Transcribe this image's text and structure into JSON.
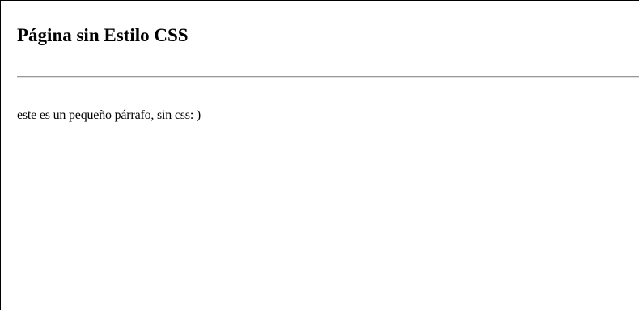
{
  "page": {
    "heading": "Página sin Estilo CSS",
    "paragraph": "este es un pequeño párrafo, sin css: )"
  }
}
